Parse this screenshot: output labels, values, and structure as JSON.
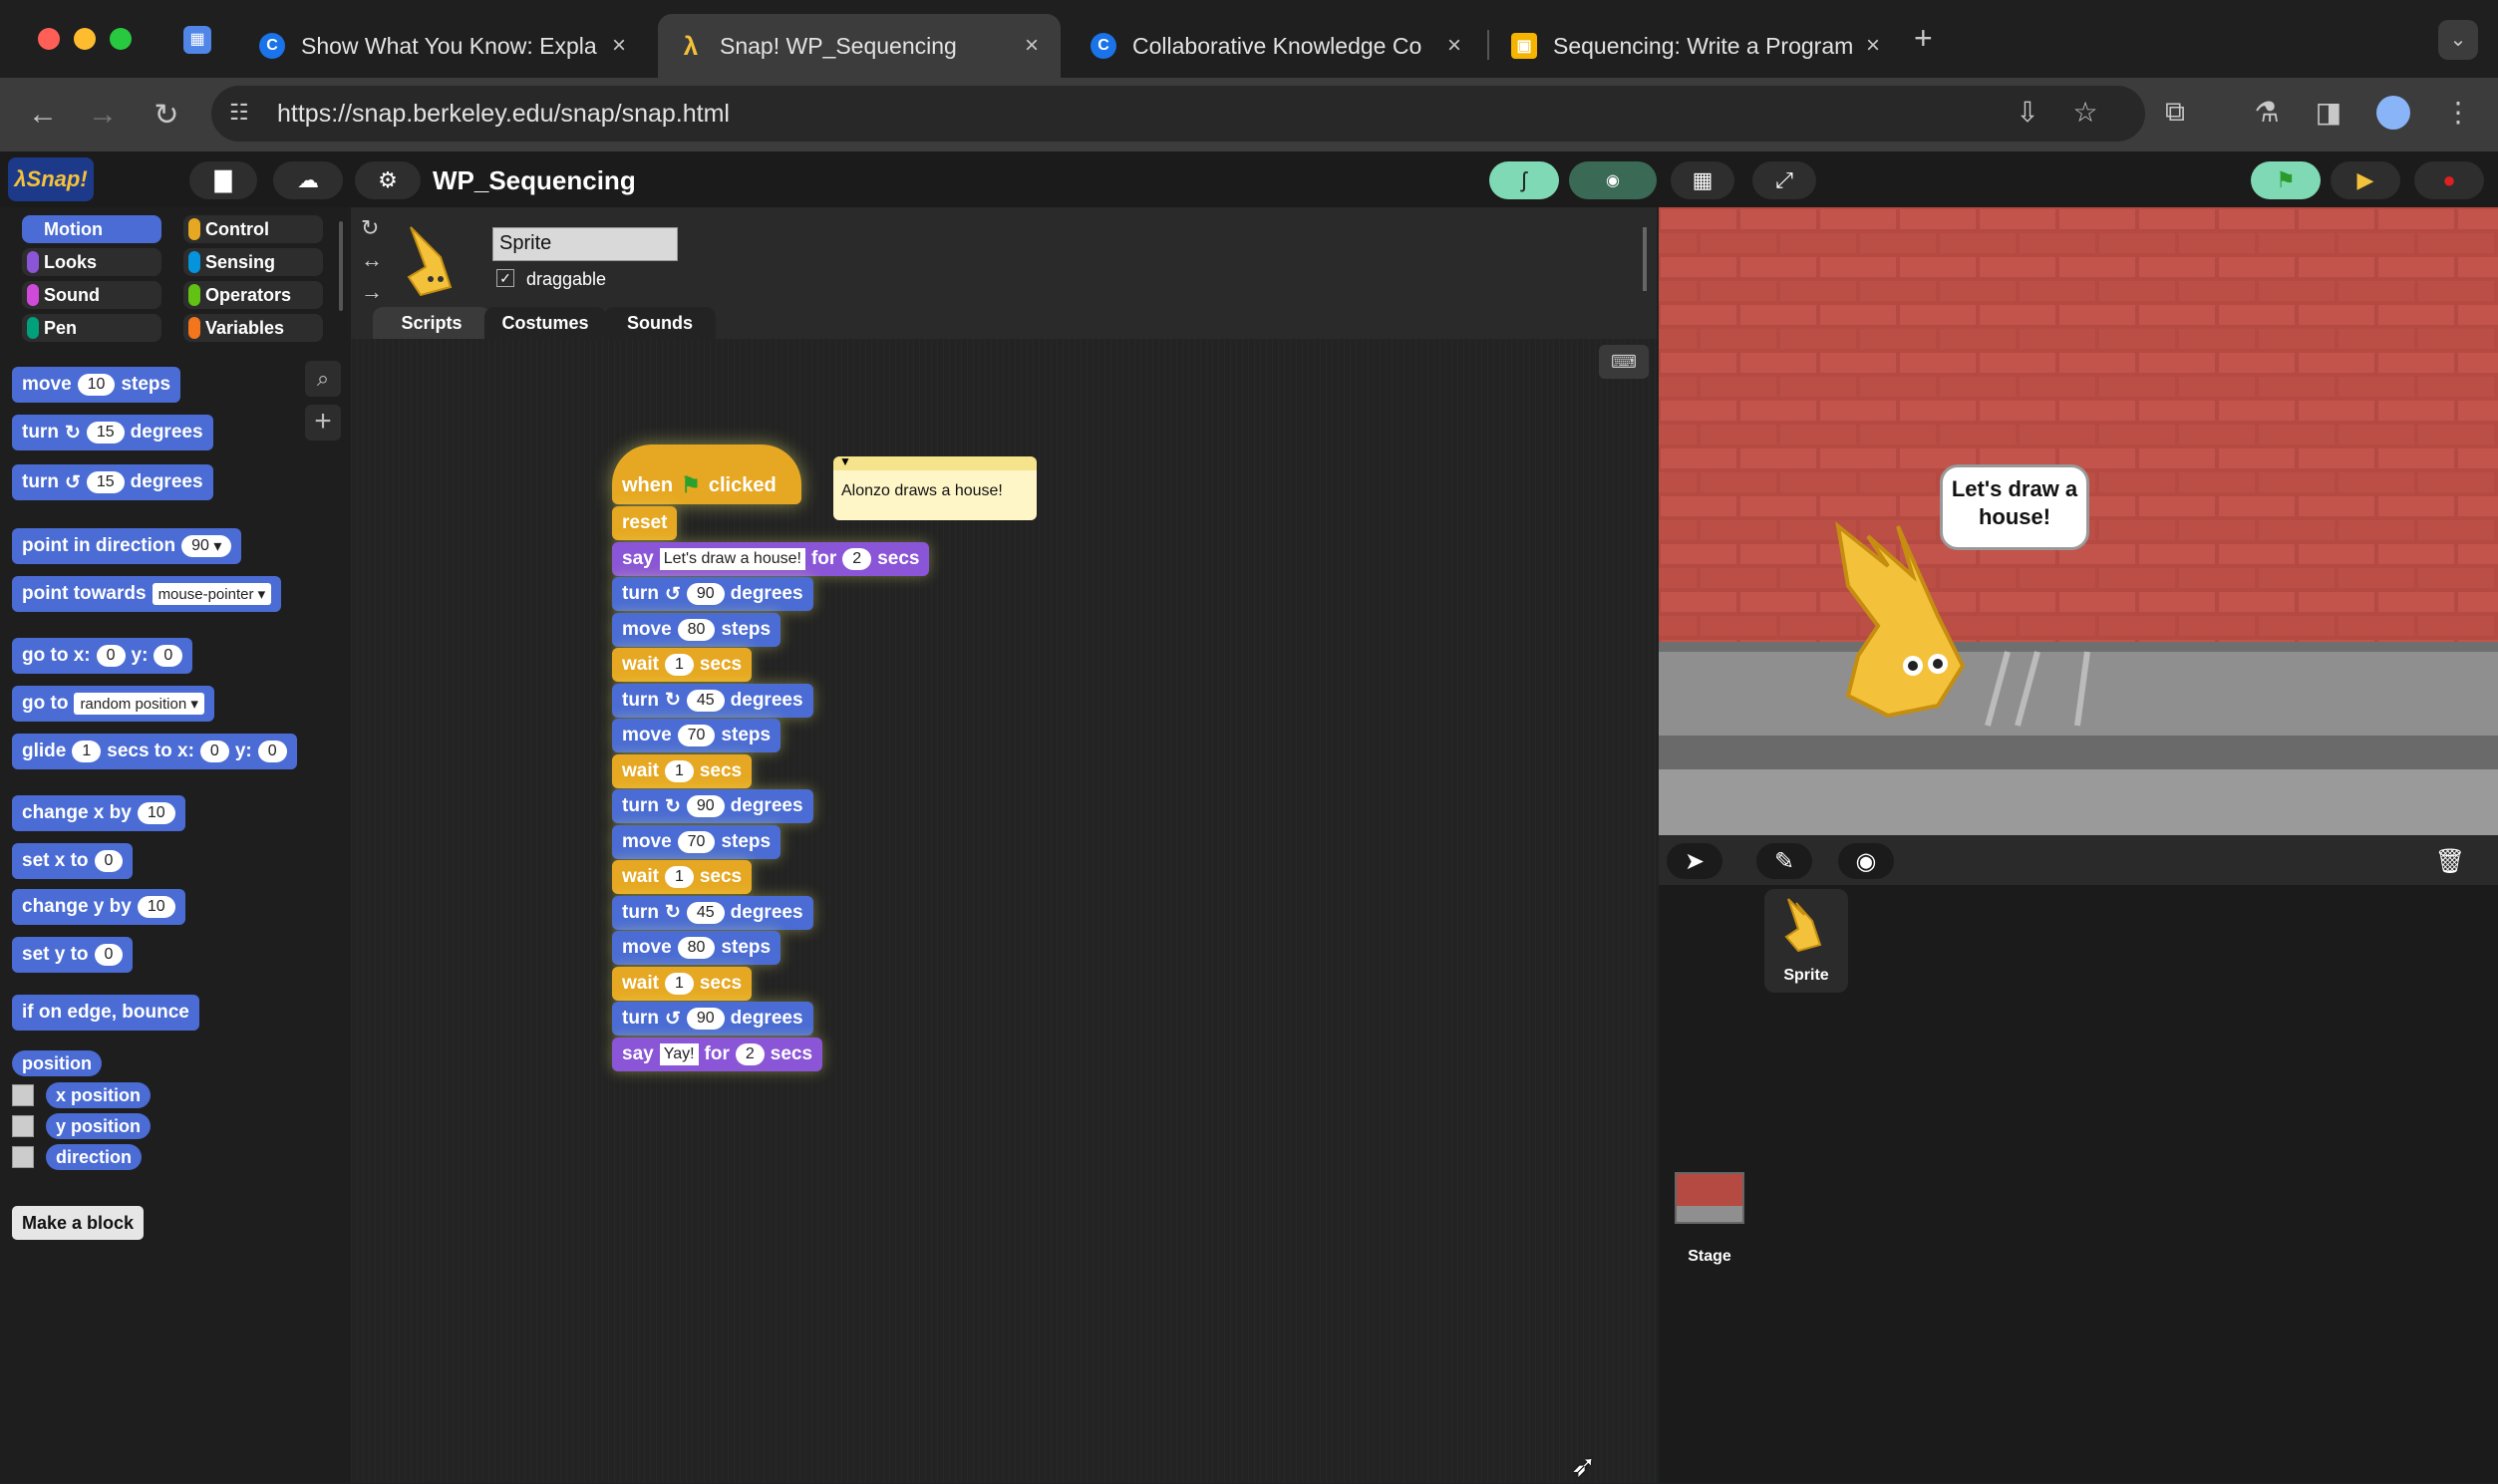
{
  "browser": {
    "tabs": [
      {
        "title": "Show What You Know: Expla",
        "icon": "C"
      },
      {
        "title": "Snap! WP_Sequencing",
        "icon": "λ"
      },
      {
        "title": "Collaborative Knowledge Co",
        "icon": "C"
      },
      {
        "title": "Sequencing: Write a Program",
        "icon": "▣"
      }
    ],
    "new_tab": "+",
    "url": "https://snap.berkeley.edu/snap/snap.html"
  },
  "snap": {
    "project_name": "WP_Sequencing",
    "categories": [
      "Motion",
      "Looks",
      "Sound",
      "Pen",
      "Control",
      "Sensing",
      "Operators",
      "Variables"
    ],
    "palette": {
      "move": {
        "label": "move",
        "value": "10",
        "suffix": "steps"
      },
      "turn_cw": {
        "label": "turn",
        "icon": "↻",
        "value": "15",
        "suffix": "degrees"
      },
      "turn_ccw": {
        "label": "turn",
        "icon": "↺",
        "value": "15",
        "suffix": "degrees"
      },
      "point_dir": {
        "label": "point in direction",
        "value": "90"
      },
      "point_towards": {
        "label": "point towards",
        "value": "mouse-pointer"
      },
      "go_to_xy": {
        "label": "go to x:",
        "x": "0",
        "ylabel": "y:",
        "y": "0"
      },
      "go_to": {
        "label": "go to",
        "value": "random position"
      },
      "glide": {
        "label": "glide",
        "secs": "1",
        "mid": "secs to x:",
        "x": "0",
        "ylabel": "y:",
        "y": "0"
      },
      "change_x": {
        "label": "change x by",
        "value": "10"
      },
      "set_x": {
        "label": "set x to",
        "value": "0"
      },
      "change_y": {
        "label": "change y by",
        "value": "10"
      },
      "set_y": {
        "label": "set y to",
        "value": "0"
      },
      "bounce": "if on edge, bounce",
      "position": "position",
      "x_position": "x position",
      "y_position": "y position",
      "direction": "direction",
      "make_block": "Make a block"
    },
    "sprite": {
      "name": "Sprite",
      "draggable": "draggable"
    },
    "editor_tabs": [
      "Scripts",
      "Costumes",
      "Sounds"
    ],
    "script": {
      "hat": {
        "when": "when",
        "clicked": "clicked"
      },
      "comment": "Alonzo draws a house!",
      "blocks": [
        {
          "type": "ctl",
          "text": "reset"
        },
        {
          "type": "lks",
          "text": "say",
          "arg": "Let's draw a house!",
          "mid": "for",
          "num": "2",
          "suffix": "secs"
        },
        {
          "type": "mot",
          "text": "turn",
          "icon": "↺",
          "num": "90",
          "suffix": "degrees"
        },
        {
          "type": "mot",
          "text": "move",
          "num": "80",
          "suffix": "steps"
        },
        {
          "type": "ctl",
          "text": "wait",
          "num": "1",
          "suffix": "secs"
        },
        {
          "type": "mot",
          "text": "turn",
          "icon": "↻",
          "num": "45",
          "suffix": "degrees"
        },
        {
          "type": "mot",
          "text": "move",
          "num": "70",
          "suffix": "steps"
        },
        {
          "type": "ctl",
          "text": "wait",
          "num": "1",
          "suffix": "secs"
        },
        {
          "type": "mot",
          "text": "turn",
          "icon": "↻",
          "num": "90",
          "suffix": "degrees"
        },
        {
          "type": "mot",
          "text": "move",
          "num": "70",
          "suffix": "steps"
        },
        {
          "type": "ctl",
          "text": "wait",
          "num": "1",
          "suffix": "secs"
        },
        {
          "type": "mot",
          "text": "turn",
          "icon": "↻",
          "num": "45",
          "suffix": "degrees"
        },
        {
          "type": "mot",
          "text": "move",
          "num": "80",
          "suffix": "steps"
        },
        {
          "type": "ctl",
          "text": "wait",
          "num": "1",
          "suffix": "secs"
        },
        {
          "type": "mot",
          "text": "turn",
          "icon": "↺",
          "num": "90",
          "suffix": "degrees"
        },
        {
          "type": "lks",
          "text": "say",
          "arg": "Yay!",
          "mid": "for",
          "num": "2",
          "suffix": "secs"
        }
      ]
    },
    "stage": {
      "speech": "Let's draw a house!"
    },
    "corral": {
      "sprite_label": "Sprite",
      "stage_label": "Stage"
    },
    "colors": {
      "motion": "#4a6cd4",
      "control": "#e6a822",
      "looks": "#8a55d7",
      "stage_brick": "#b0463f"
    }
  }
}
